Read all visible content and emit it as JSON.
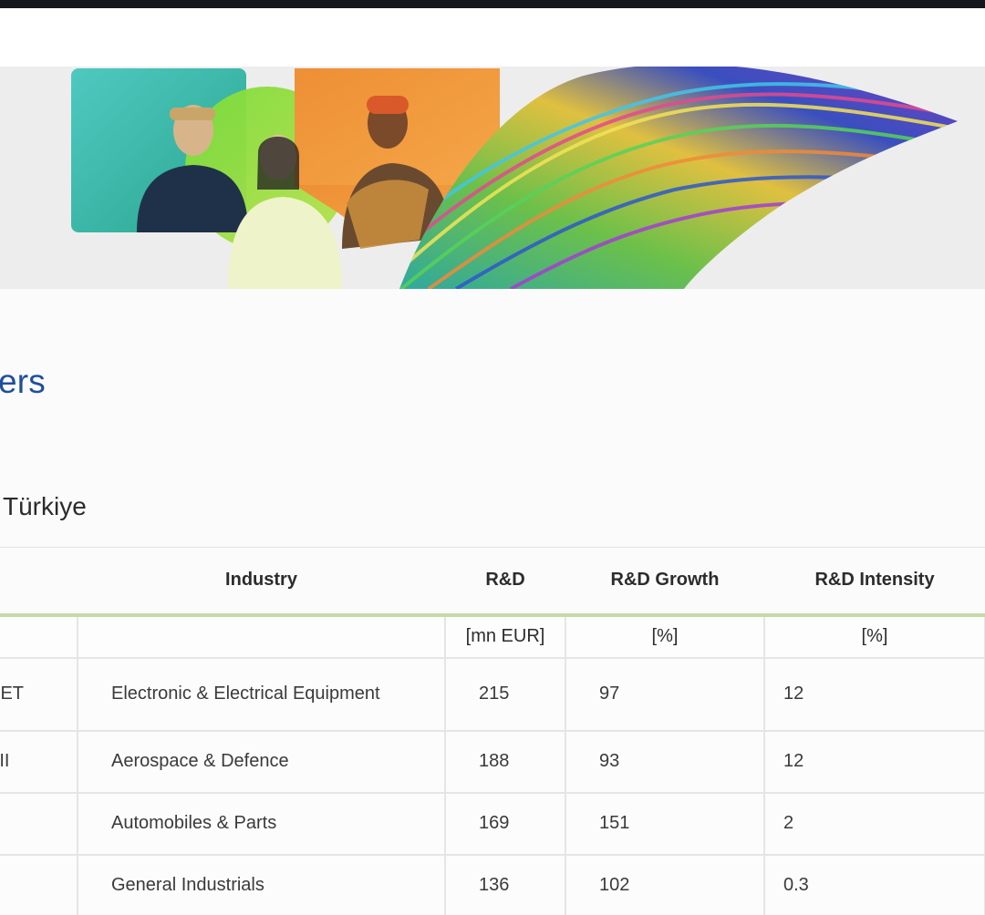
{
  "page": {
    "heading_partial": "ers",
    "subheading_partial": "Türkiye"
  },
  "hero": {
    "image_alt_people": "three-people-portrait",
    "image_alt_art": "colorful-textile-wave"
  },
  "table": {
    "headers": [
      "",
      "Industry",
      "R&D",
      "R&D Growth",
      "R&D Intensity"
    ],
    "units": [
      "",
      "",
      "[mn EUR]",
      "[%]",
      "[%]"
    ],
    "rows": [
      {
        "company": "RET",
        "industry": "Electronic & Electrical Equipment",
        "rd": "215",
        "growth": "97",
        "intensity": "12"
      },
      {
        "company": "YII",
        "industry": "Aerospace & Defence",
        "rd": "188",
        "growth": "93",
        "intensity": "12"
      },
      {
        "company": "",
        "industry": "Automobiles & Parts",
        "rd": "169",
        "growth": "151",
        "intensity": "2"
      },
      {
        "company": "",
        "industry": "General Industrials",
        "rd": "136",
        "growth": "102",
        "intensity": "0.3"
      }
    ]
  },
  "colors": {
    "heading_blue": "#1f4f9c",
    "header_underline": "#c6d9a6",
    "top_bar": "#15151c"
  }
}
